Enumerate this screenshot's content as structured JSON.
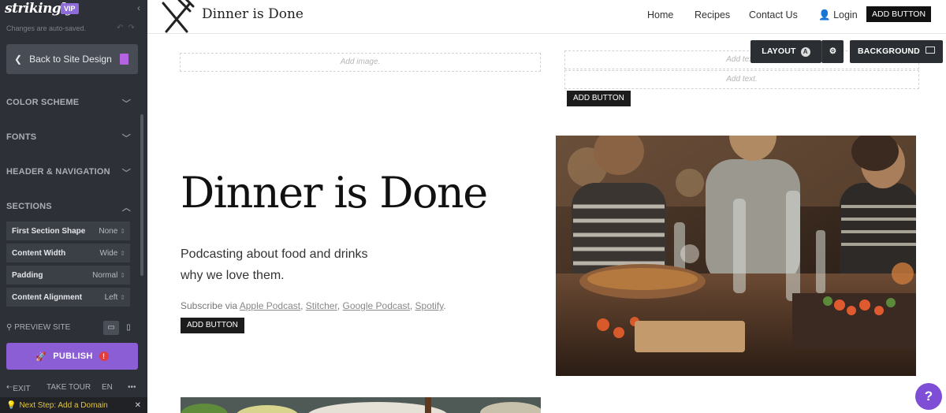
{
  "editor": {
    "brand": "strikingly",
    "badge": "VIP",
    "autosave": "Changes are auto-saved.",
    "back_label": "Back to Site Design",
    "sections": [
      {
        "label": "COLOR SCHEME"
      },
      {
        "label": "FONTS"
      },
      {
        "label": "HEADER & NAVIGATION"
      },
      {
        "label": "SECTIONS"
      }
    ],
    "options": [
      {
        "label": "First Section Shape",
        "value": "None"
      },
      {
        "label": "Content Width",
        "value": "Wide"
      },
      {
        "label": "Padding",
        "value": "Normal"
      },
      {
        "label": "Content Alignment",
        "value": "Left"
      }
    ],
    "preview_label": "PREVIEW SITE",
    "publish_label": "PUBLISH",
    "publish_alert": "!",
    "footer": {
      "exit": "EXIT",
      "tour": "TAKE TOUR",
      "lang": "EN",
      "more": "•••"
    },
    "next_step": "Next Step: Add a Domain"
  },
  "site": {
    "title": "Dinner is Done",
    "nav": [
      "Home",
      "Recipes",
      "Contact Us",
      "Login"
    ],
    "nav_button": "ADD BUTTON"
  },
  "canvas": {
    "add_image": "Add image.",
    "add_text_1": "Add text.",
    "add_text_2": "Add text.",
    "add_button": "ADD BUTTON",
    "layout_label": "LAYOUT",
    "background_label": "BACKGROUND"
  },
  "hero": {
    "title": "Dinner is Done",
    "line1": "Podcasting about food and drinks",
    "line2": "why we love them.",
    "subscribe_prefix": "Subscribe via ",
    "links": [
      "Apple Podcast",
      "Stitcher",
      "Google Podcast",
      "Spotify"
    ],
    "button": "ADD BUTTON"
  },
  "help_label": "?"
}
